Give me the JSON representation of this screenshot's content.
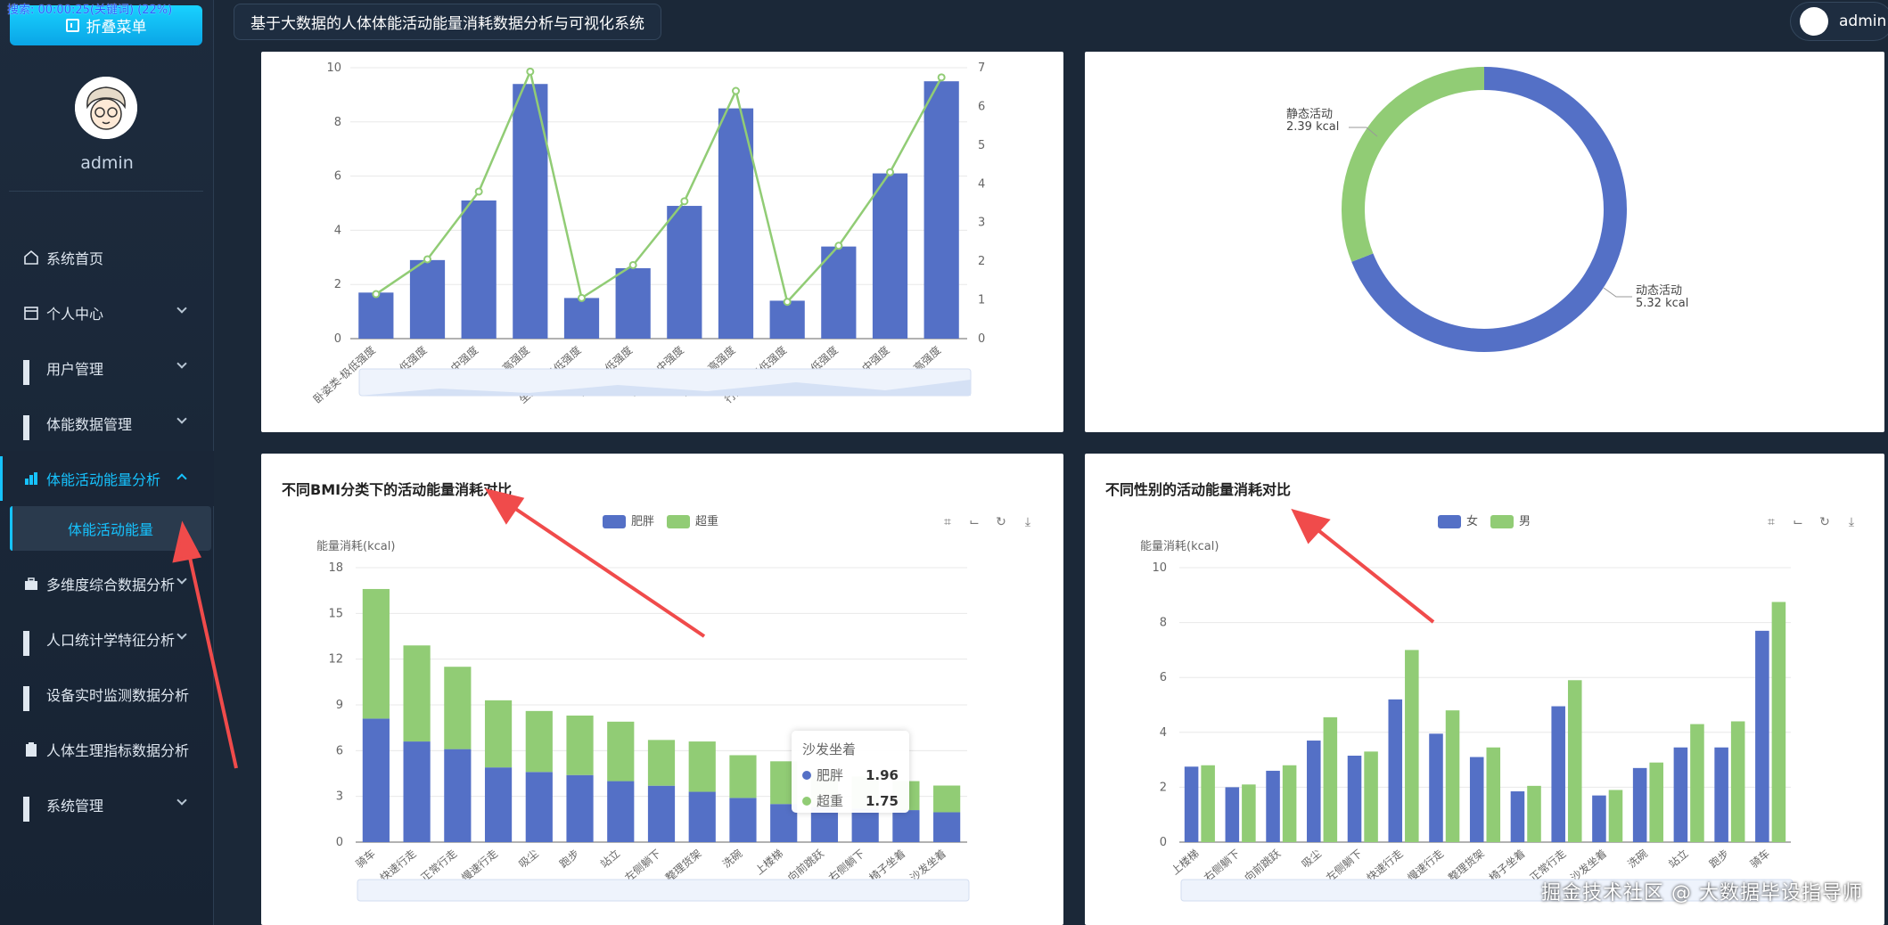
{
  "app": {
    "title": "基于大数据的人体体能活动能量消耗数据分析与可视化系统",
    "search_status": "搜索: 00:00:25(关键词) (22%)",
    "collapse_label": "折叠菜单",
    "username": "admin",
    "header_user": "admin",
    "watermark": "掘金技术社区 @ 大数据毕设指导师"
  },
  "sidebar": {
    "items": [
      {
        "label": "系统首页",
        "icon": "home-icon",
        "has_submenu": false
      },
      {
        "label": "个人中心",
        "icon": "calendar-icon",
        "has_submenu": true
      },
      {
        "label": "用户管理",
        "icon": "grid-icon",
        "has_submenu": true
      },
      {
        "label": "体能数据管理",
        "icon": "grid-icon",
        "has_submenu": true
      },
      {
        "label": "体能活动能量分析",
        "icon": "chart-icon",
        "has_submenu": true,
        "expanded": true,
        "active": true
      },
      {
        "label": "多维度综合数据分析",
        "icon": "briefcase-icon",
        "has_submenu": true
      },
      {
        "label": "人口统计学特征分析",
        "icon": "grid-icon",
        "has_submenu": true
      },
      {
        "label": "设备实时监测数据分析",
        "icon": "grid-icon",
        "has_submenu": false
      },
      {
        "label": "人体生理指标数据分析",
        "icon": "clipboard-icon",
        "has_submenu": false
      },
      {
        "label": "系统管理",
        "icon": "grid-icon",
        "has_submenu": true
      }
    ],
    "subitem": "体能活动能量"
  },
  "chart_data": [
    {
      "type": "bar",
      "categories": [
        "卧姿类-极低强度",
        "卧姿类-低强度",
        "卧姿类-中强度",
        "卧姿类-高强度",
        "坐姿类-极低强度",
        "坐姿类-低强度",
        "坐姿类-中强度",
        "坐姿类-高强度",
        "行走类-极低强度",
        "行走类-低强度",
        "行走类-中强度",
        "行走类-高强度"
      ],
      "series": [
        {
          "type": "bar",
          "values": [
            1.7,
            2.9,
            5.1,
            9.4,
            1.5,
            2.6,
            4.9,
            8.5,
            1.4,
            3.4,
            6.1,
            9.5
          ]
        },
        {
          "type": "line",
          "values": [
            1.15,
            2.05,
            3.8,
            6.9,
            1.05,
            1.9,
            3.55,
            6.4,
            0.95,
            2.4,
            4.3,
            6.75
          ]
        }
      ],
      "ylim": [
        0,
        10
      ],
      "y_ticks": [
        0,
        2,
        4,
        6,
        8,
        10
      ],
      "y2lim": [
        0,
        7
      ],
      "y2_ticks": [
        0,
        1,
        2,
        3,
        4,
        5,
        6,
        7
      ],
      "colors": [
        "#5470c6",
        "#91cc75"
      ]
    },
    {
      "type": "pie",
      "style": "donut",
      "slices": [
        {
          "name": "静态活动",
          "value": 2.39,
          "label": "2.39 kcal",
          "color": "#91cc75"
        },
        {
          "name": "动态活动",
          "value": 5.32,
          "label": "5.32 kcal",
          "color": "#5470c6"
        }
      ]
    },
    {
      "type": "bar",
      "stacked": true,
      "title": "不同BMI分类下的活动能量消耗对比",
      "ylabel": "能量消耗(kcal)",
      "ylim": [
        0,
        18
      ],
      "y_ticks": [
        0,
        3,
        6,
        9,
        12,
        15,
        18
      ],
      "categories": [
        "骑车",
        "快速行走",
        "正常行走",
        "慢速行走",
        "吸尘",
        "跑步",
        "站立",
        "左侧躺下",
        "整理货架",
        "洗碗",
        "上楼梯",
        "向前跳跃",
        "右侧躺下",
        "椅子坐着",
        "沙发坐着"
      ],
      "series": [
        {
          "name": "肥胖",
          "color": "#5470c6",
          "values": [
            8.1,
            6.6,
            6.1,
            4.9,
            4.6,
            4.4,
            4.0,
            3.7,
            3.3,
            2.9,
            2.5,
            2.3,
            2.2,
            2.1,
            1.96
          ]
        },
        {
          "name": "超重",
          "color": "#91cc75",
          "values": [
            8.5,
            6.3,
            5.4,
            4.4,
            4.0,
            3.9,
            3.9,
            3.0,
            3.3,
            2.8,
            2.8,
            2.3,
            2.1,
            1.9,
            1.75
          ]
        }
      ],
      "tooltip": {
        "title": "沙发坐着",
        "rows": [
          {
            "name": "肥胖",
            "value": "1.96"
          },
          {
            "name": "超重",
            "value": "1.75"
          }
        ]
      }
    },
    {
      "type": "bar",
      "title": "不同性别的活动能量消耗对比",
      "ylabel": "能量消耗(kcal)",
      "ylim": [
        0,
        10
      ],
      "y_ticks": [
        0,
        2,
        4,
        6,
        8,
        10
      ],
      "categories": [
        "上楼梯",
        "右侧躺下",
        "向前跳跃",
        "吸尘",
        "左侧躺下",
        "快速行走",
        "慢速行走",
        "整理货架",
        "椅子坐着",
        "正常行走",
        "沙发坐着",
        "洗碗",
        "站立",
        "跑步",
        "骑车"
      ],
      "series": [
        {
          "name": "女",
          "color": "#5470c6",
          "values": [
            2.75,
            2.0,
            2.6,
            3.7,
            3.15,
            5.2,
            3.95,
            3.1,
            1.85,
            4.95,
            1.7,
            2.7,
            3.45,
            3.45,
            7.7
          ]
        },
        {
          "name": "男",
          "color": "#91cc75",
          "values": [
            2.8,
            2.1,
            2.8,
            4.55,
            3.3,
            7.0,
            4.8,
            3.45,
            2.05,
            5.9,
            1.9,
            2.9,
            4.3,
            4.4,
            8.75
          ]
        }
      ]
    }
  ]
}
